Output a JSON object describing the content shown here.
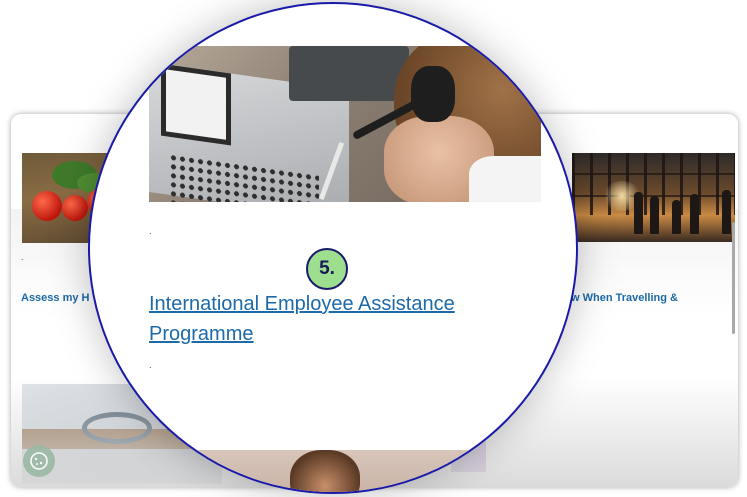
{
  "cards": {
    "left_label": "Assess my H",
    "right_label": "w When Travelling &",
    "dot": "."
  },
  "lens": {
    "step_badge": "5.",
    "link_label": "International Employee Assistance Programme",
    "dot": "."
  },
  "icons": {
    "cookie": "cookie-icon"
  },
  "colors": {
    "link": "#1c6aa8",
    "badge_bg": "#9ddf8f",
    "lens_border": "#1a1aa8"
  }
}
